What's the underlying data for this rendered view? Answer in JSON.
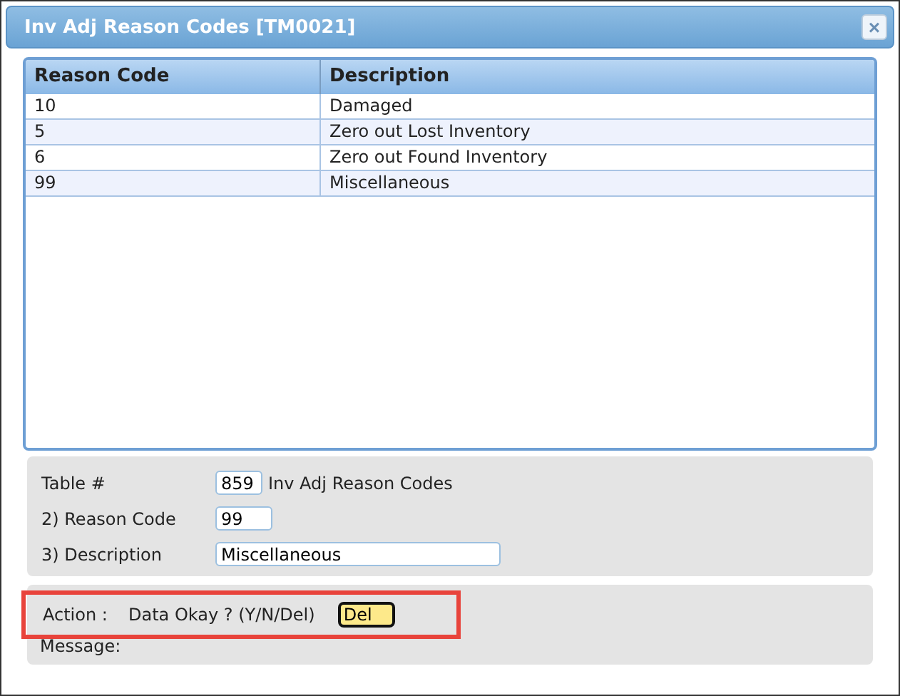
{
  "window": {
    "title": "Inv Adj Reason Codes [TM0021]",
    "close": "×"
  },
  "table": {
    "columns": [
      "Reason Code",
      "Description"
    ],
    "rows": [
      {
        "cells": [
          "10",
          "Damaged"
        ]
      },
      {
        "cells": [
          "5",
          "Zero out Lost Inventory"
        ]
      },
      {
        "cells": [
          "6",
          "Zero out Found Inventory"
        ]
      },
      {
        "cells": [
          "99",
          "Miscellaneous"
        ]
      }
    ]
  },
  "form": {
    "table_label": "Table #",
    "table_value": "859",
    "table_name": "Inv Adj Reason Codes",
    "fields": [
      {
        "label": "2) Reason Code",
        "value": "99",
        "wide": false
      },
      {
        "label": "3) Description",
        "value": "Miscellaneous",
        "wide": true
      }
    ]
  },
  "action": {
    "label": "Action :",
    "prompt": "Data Okay ? (Y/N/Del)",
    "value": "Del",
    "highlighted": true,
    "message_label": "Message:"
  }
}
